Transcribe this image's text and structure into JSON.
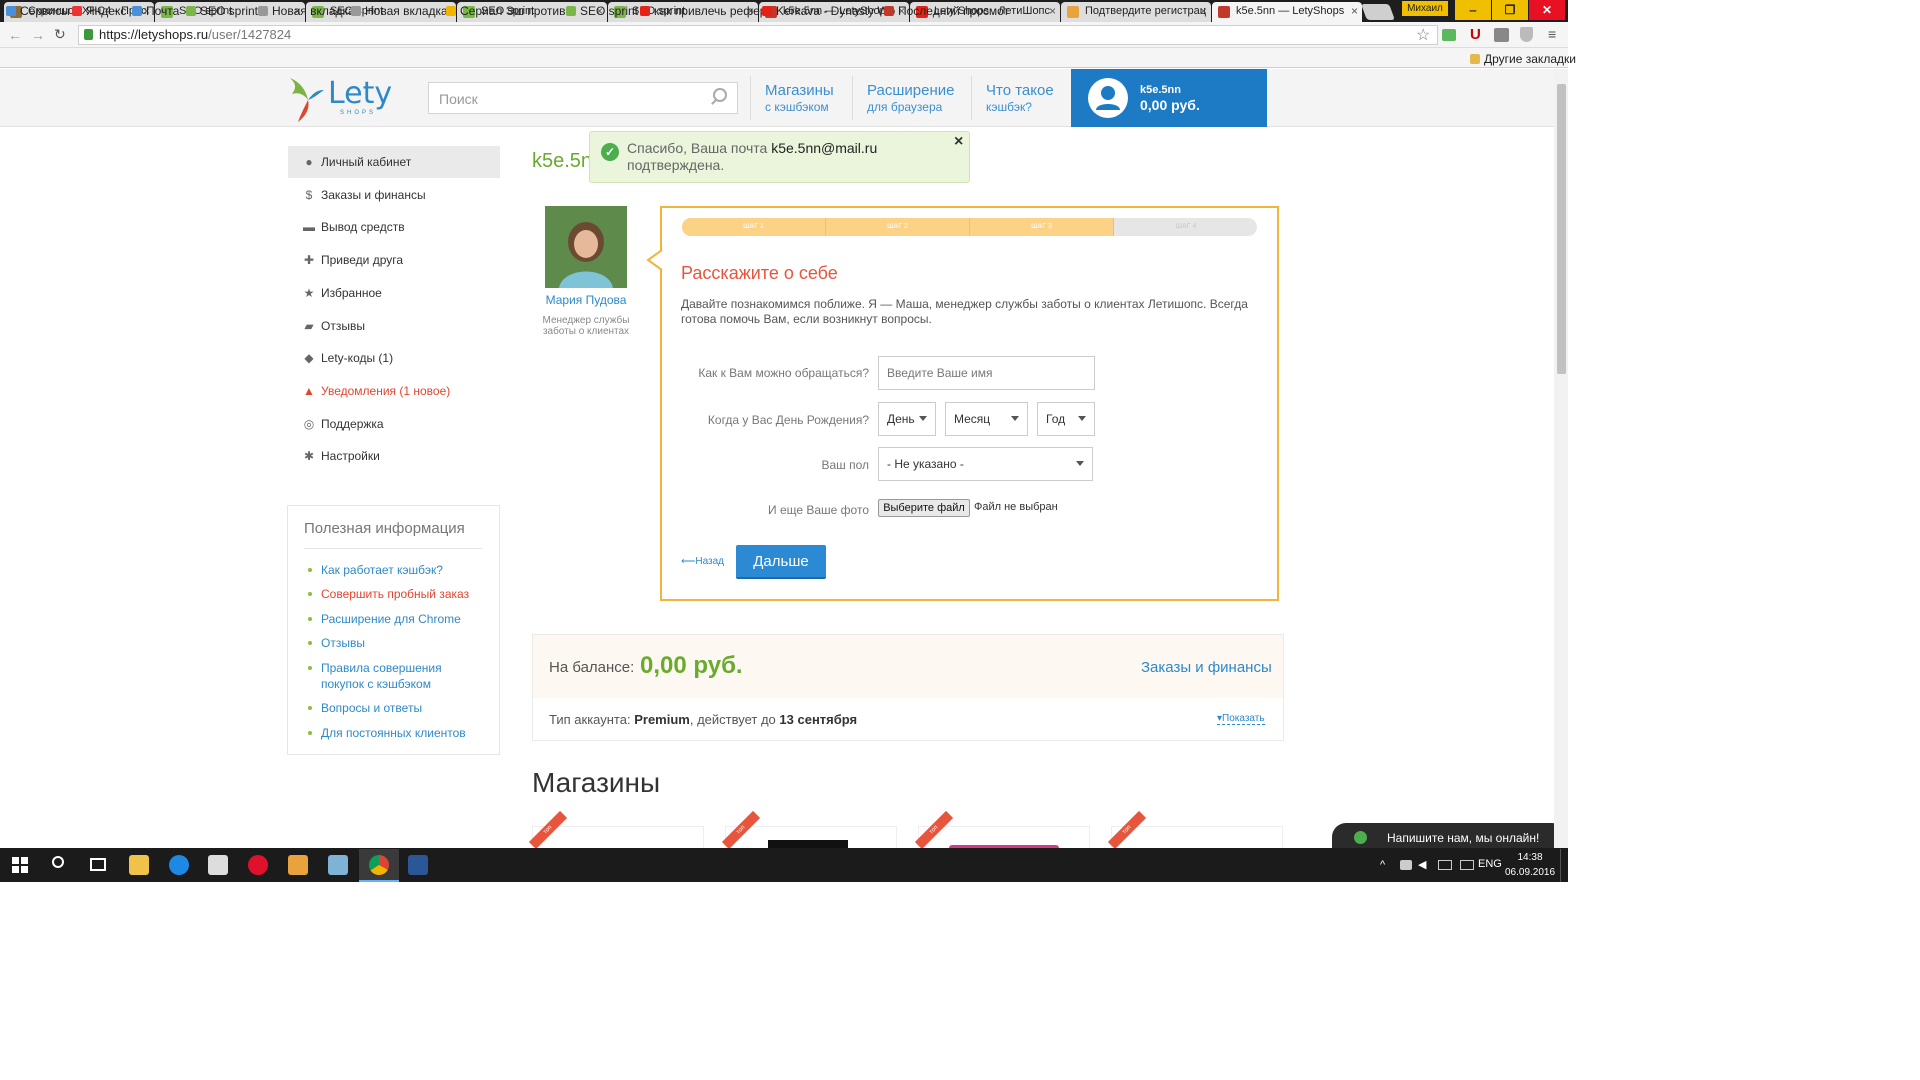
{
  "browser": {
    "tabs": [
      {
        "label": "Скриншот XHC4 - Прос",
        "color": "#8a6d3b"
      },
      {
        "label": "SEO sprint",
        "color": "#7ab648"
      },
      {
        "label": "SEO sprint",
        "color": "#7ab648"
      },
      {
        "label": "SEO sprint",
        "color": "#7ab648"
      },
      {
        "label": "SEO sprint",
        "color": "#7ab648"
      },
      {
        "label": "k5e.5nn — LetyShops",
        "color": "#c0392b"
      },
      {
        "label": "Lety Shops . ЛетиШопс",
        "color": "#e62117"
      },
      {
        "label": "Подтвердите регистрац",
        "color": "#e8a33d"
      },
      {
        "label": "k5e.5nn — LetyShops",
        "color": "#c0392b"
      }
    ],
    "profile_name": "Михаил",
    "url_host": "https://letyshops.ru",
    "url_path": "/user/1427824",
    "bookmarks": [
      "Сервисы",
      "Яндекс",
      "Почта",
      "SEO sprint",
      "Новая вкладка",
      "Новая вкладка",
      "Сериал Эш против",
      "SEO sprint",
      "как привлечь рефер",
      "Kerkava - Dynasty Wo",
      "Последний просмот"
    ],
    "other_bookmarks": "Другие закладки"
  },
  "header": {
    "logo_text": "Lety",
    "logo_sub": "SHOPS",
    "search_placeholder": "Поиск",
    "nav": [
      {
        "title": "Магазины",
        "sub": "с кэшбэком"
      },
      {
        "title": "Расширение",
        "sub": "для браузера"
      },
      {
        "title": "Что такое",
        "sub": "кэшбэк?"
      }
    ],
    "user_name": "k5e.5nn",
    "user_balance": "0,00 руб."
  },
  "sidebar": {
    "items": [
      {
        "label": "Личный кабинет",
        "icon": "user-icon"
      },
      {
        "label": "Заказы и финансы",
        "icon": "dollar-icon"
      },
      {
        "label": "Вывод средств",
        "icon": "card-icon"
      },
      {
        "label": "Приведи друга",
        "icon": "add-user-icon"
      },
      {
        "label": "Избранное",
        "icon": "star-icon"
      },
      {
        "label": "Отзывы",
        "icon": "comments-icon"
      },
      {
        "label": "Lety-коды (1)",
        "icon": "tag-icon"
      },
      {
        "label": "Уведомления (1 новое)",
        "icon": "bell-icon"
      },
      {
        "label": "Поддержка",
        "icon": "lifebuoy-icon"
      },
      {
        "label": "Настройки",
        "icon": "gear-icon"
      }
    ],
    "info_title": "Полезная информация",
    "info_links": [
      "Как работает кэшбэк?",
      "Совершить пробный заказ",
      "Расширение для Chrome",
      "Отзывы",
      "Правила совершения покупок с кэшбэком",
      "Вопросы и ответы",
      "Для постоянных клиентов"
    ]
  },
  "main": {
    "title": "k5e.5n",
    "toast": {
      "text_before": "Спасибо, Ваша почта",
      "email": "k5e.5nn@mail.ru",
      "text_after": "подтверждена.",
      "close": "×"
    },
    "manager": {
      "name": "Мария Пудова",
      "role": "Менеджер службы заботы о клиентах"
    },
    "quiz": {
      "steps": [
        "ШАГ 1",
        "ШАГ 2",
        "ШАГ 3",
        "ШАГ 4"
      ],
      "steps_done": 3,
      "title": "Расскажите о себе",
      "intro": "Давайте познакомимся поближе. Я — Маша, менеджер службы заботы о клиентах Летишопс. Всегда готова помочь Вам, если возникнут вопросы.",
      "name_label": "Как к Вам можно обращаться?",
      "name_placeholder": "Введите Ваше имя",
      "birthday_label": "Когда у Вас День Рождения?",
      "day": "День",
      "month": "Месяц",
      "year": "Год",
      "gender_label": "Ваш пол",
      "gender_value": "- Не указано -",
      "photo_label": "И еще Ваше фото",
      "file_button": "Выберите файл",
      "file_status": "Файл не выбран",
      "back": "Назад",
      "next": "Дальше"
    },
    "balance": {
      "label": "На балансе:",
      "amount": "0,00 руб.",
      "orders_link": "Заказы и финансы",
      "account_prefix": "Тип аккаунта:",
      "account_type": "Premium",
      "valid_prefix": ", действует до",
      "valid_date": "13 сентября",
      "show_link": "Показать"
    },
    "shops_title": "Магазины",
    "shop_ribbon": "топ"
  },
  "chat": {
    "label": "Напишите нам, мы онлайн!"
  },
  "taskbar": {
    "lang": "ENG",
    "time": "14:38",
    "date": "06.09.2016"
  }
}
